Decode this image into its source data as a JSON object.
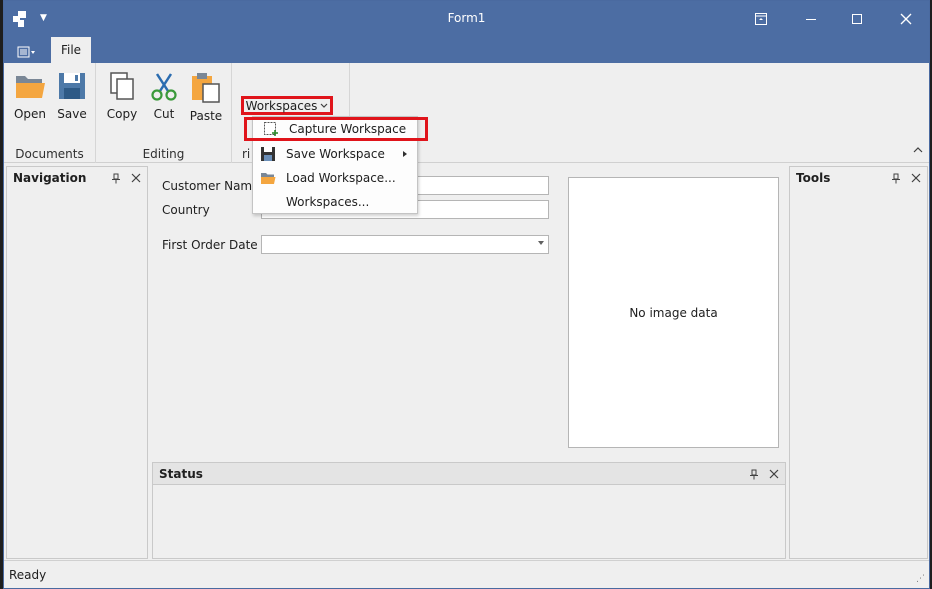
{
  "window": {
    "title": "Form1"
  },
  "ribbon": {
    "tabs": [
      {
        "label": "File"
      }
    ],
    "groups": {
      "documents": {
        "caption": "Documents",
        "buttons": [
          {
            "label": "Open",
            "icon": "folder-open-icon"
          },
          {
            "label": "Save",
            "icon": "floppy-disk-icon"
          }
        ]
      },
      "editing": {
        "caption": "Editing",
        "buttons": [
          {
            "label": "Copy",
            "icon": "copy-icon"
          },
          {
            "label": "Cut",
            "icon": "scissors-icon"
          },
          {
            "label": "Paste",
            "icon": "clipboard-paste-icon"
          }
        ]
      },
      "third": {
        "caption_partial": "ri"
      }
    },
    "workspaces_button": "Workspaces"
  },
  "workspaces_menu": {
    "items": [
      {
        "label": "Capture Workspace",
        "icon": "capture-workspace-icon",
        "highlighted": true
      },
      {
        "label": "Save Workspace",
        "icon": "floppy-disk-icon",
        "submenu": true
      },
      {
        "label": "Load Workspace...",
        "icon": "folder-open-icon"
      },
      {
        "label": "Workspaces...",
        "icon": ""
      }
    ]
  },
  "panels": {
    "navigation": {
      "title": "Navigation"
    },
    "tools": {
      "title": "Tools"
    },
    "status": {
      "title": "Status"
    }
  },
  "form": {
    "customer_name": {
      "label": "Customer Name",
      "value": ""
    },
    "country": {
      "label": "Country",
      "value": ""
    },
    "first_order_date": {
      "label": "First Order Date",
      "value": ""
    },
    "image_placeholder": "No image data"
  },
  "statusbar": {
    "text": "Ready"
  },
  "colors": {
    "title_bar": "#4c6da3",
    "highlight_box": "#e0141b",
    "background": "#efefef"
  }
}
